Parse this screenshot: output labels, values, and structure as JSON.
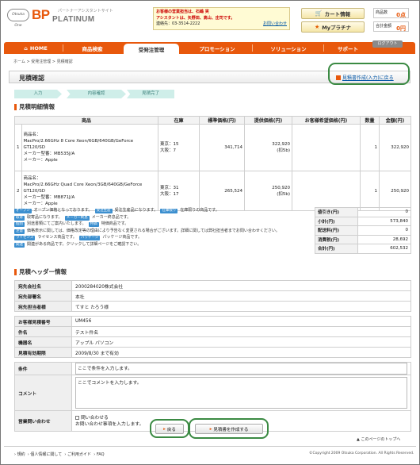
{
  "header": {
    "logo_small": "Otsuka One",
    "logo_main": "BP",
    "logo_sub": "PLATINUM",
    "logo_caption": "パートナーアシスタントサイト",
    "info_line1": "お客様の営業担当は、石嶋 実",
    "info_line2": "アシスタントは、矢野田、高山、庄司です。",
    "info_line3": "連絡先：03-3514-2222",
    "info_link": "お問い合わせ",
    "cart_btn": "カート情報",
    "myplatina_btn": "Myプラチナ",
    "count_label1": "商品数",
    "count_value1": "0点",
    "count_label2": "合計金額",
    "count_value2": "0円",
    "logout": "ログアウト"
  },
  "nav": [
    {
      "label": "HOME"
    },
    {
      "label": "商品検索"
    },
    {
      "label": "受発注管理"
    },
    {
      "label": "プロモーション"
    },
    {
      "label": "ソリューション"
    },
    {
      "label": "サポート"
    }
  ],
  "breadcrumb": "ホーム > 受発注管理 > 見積確認",
  "page_title": "見積確認",
  "back_link": "見積書作成(入力)に戻る",
  "steps": [
    "入力",
    "内容確認",
    "見積完了"
  ],
  "detail_section": "見積明細情報",
  "detail_headers": [
    "商品",
    "在庫",
    "標準価格(円)",
    "提供価格(円)",
    "お客様希望価格(円)",
    "数量",
    "金額(円)"
  ],
  "detail_rows": [
    {
      "no": "1",
      "name_label": "商品名：",
      "name": "MacPro/2.66GHz 8 Core Xeon/6GB/640GB/GeForce GT120/SD",
      "maker_code": "メーカー型番：MB535J/A",
      "maker": "メーカー：Apple",
      "stock1": "東京：15",
      "stock2": "大阪：7",
      "std": "341,714",
      "offer": "322,920",
      "offer_tax": "(扣5b)",
      "qty": "1",
      "amount": "322,920"
    },
    {
      "no": "2",
      "name_label": "商品名：",
      "name": "MacPro/2.66GHz Quad Core Xeon/3GB/640GB/GeForce GT120/SD",
      "maker_code": "メーカー型番：MB871J/A",
      "maker": "メーカー：Apple",
      "stock1": "東京：31",
      "stock2": "大阪：17",
      "std": "265,524",
      "offer": "250,920",
      "offer_tax": "(扣5b)",
      "qty": "1",
      "amount": "250,920"
    }
  ],
  "legend": [
    {
      "badge": "オープン",
      "text": "オープン価格となっております。"
    },
    {
      "badge": "受注生産",
      "text": "受注生産品になります。"
    },
    {
      "badge": "取寄",
      "text": "取寄品になります。"
    },
    {
      "badge": "特価",
      "text": "特価商品です。"
    },
    {
      "badge": "在庫限り",
      "text": "在庫限りの商品です。"
    },
    {
      "badge": "メーカー終息",
      "text": "メーカー終息品です。"
    },
    {
      "badge": "個別",
      "text": "別途書類にてご案内いたします。"
    },
    {
      "badge": "注意",
      "text": "価格表示に関しては、価格改定等の理由により予告なく変更される場合がございます。詳細に関しては弊社担当者までお問い合わせください。"
    },
    {
      "badge": "ライセンス",
      "text": "ライセンス商品です。"
    },
    {
      "badge": "パッケージ",
      "text": "パッケージ商品です。"
    },
    {
      "badge": "関連",
      "text": "関連がある商品です。クリックして詳細ページをご確認下さい。"
    }
  ],
  "summary": [
    {
      "label": "値引き(円)",
      "value": "0"
    },
    {
      "label": "小計(円)",
      "value": "573,840"
    },
    {
      "label": "配送料(円)",
      "value": "0"
    },
    {
      "label": "消費税(円)",
      "value": "28,692"
    },
    {
      "label": "合計(円)",
      "value": "602,532"
    }
  ],
  "header_section": "見積ヘッダー情報",
  "header_rows": [
    {
      "label": "宛先会社名",
      "value": "2000284020株式会社"
    },
    {
      "label": "宛先部署名",
      "value": "本社"
    },
    {
      "label": "宛先担当者様",
      "value": "てすと たろう様"
    },
    {
      "label": "お客様見積番号",
      "value": "UM456"
    },
    {
      "label": "件名",
      "value": "テスト件名"
    },
    {
      "label": "機器名",
      "value": "アップル パソコン"
    },
    {
      "label": "見積有効期限",
      "value": "2009/8/30 まで有効"
    },
    {
      "label": "条件",
      "value": "ここで条件を入力します。"
    },
    {
      "label": "コメント",
      "value": "ここでコメントを入力します。"
    },
    {
      "label": "営業問い合わせ",
      "value": "問い合わせる",
      "value2": "お問い合わせ事項を入力します。"
    }
  ],
  "buttons": {
    "back": "戻る",
    "create": "見積書を作成する"
  },
  "pagetop": "このページのトップへ",
  "footer_links": [
    "規約",
    "個人情報に関して",
    "ご利用ガイド",
    "FAQ"
  ],
  "copyright": "©Copyright 2009 Otsuka Corporation. All Rights Reserved."
}
